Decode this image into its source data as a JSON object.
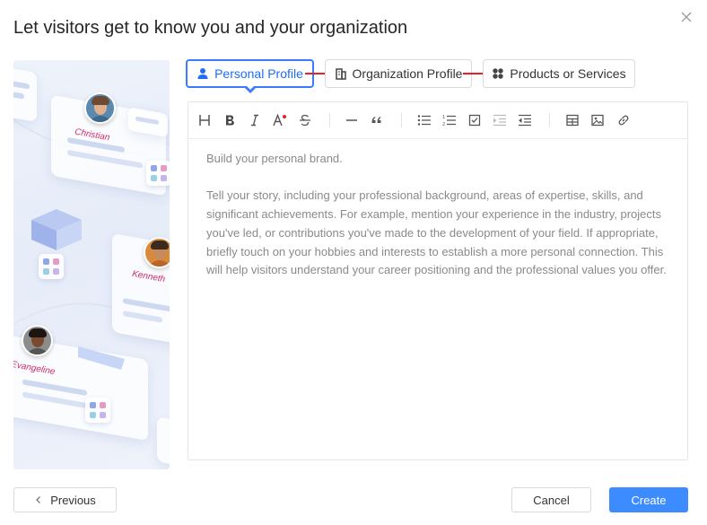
{
  "dialog": {
    "title": "Let visitors get to know you and your organization"
  },
  "illustration": {
    "people": [
      "Christian",
      "Kenneth",
      "Evangeline"
    ]
  },
  "tabs": [
    {
      "label": "Personal Profile",
      "icon": "person-icon",
      "active": true
    },
    {
      "label": "Organization Profile",
      "icon": "building-icon",
      "active": false
    },
    {
      "label": "Products or Services",
      "icon": "grid-dots-icon",
      "active": false
    }
  ],
  "toolbar": {
    "buttons": [
      "heading",
      "bold",
      "italic",
      "text-color",
      "strikethrough",
      "horizontal-rule",
      "quote",
      "bullet-list",
      "numbered-list",
      "task-list",
      "indent",
      "outdent",
      "table",
      "image",
      "link"
    ]
  },
  "editor": {
    "paragraphs": [
      "Build your personal brand.",
      "Tell your story, including your professional background, areas of expertise, skills, and significant achievements. For example, mention your experience in the industry, projects you've led, or contributions you've made to the development of your field. If appropriate, briefly touch on your hobbies and interests to establish a more personal connection. This will help visitors understand your career positioning and the professional values you offer."
    ]
  },
  "footer": {
    "previous_label": "Previous",
    "cancel_label": "Cancel",
    "create_label": "Create"
  },
  "colors": {
    "accent": "#3a7bff",
    "primary_button": "#3c8cff",
    "arrow": "#e8202a"
  }
}
